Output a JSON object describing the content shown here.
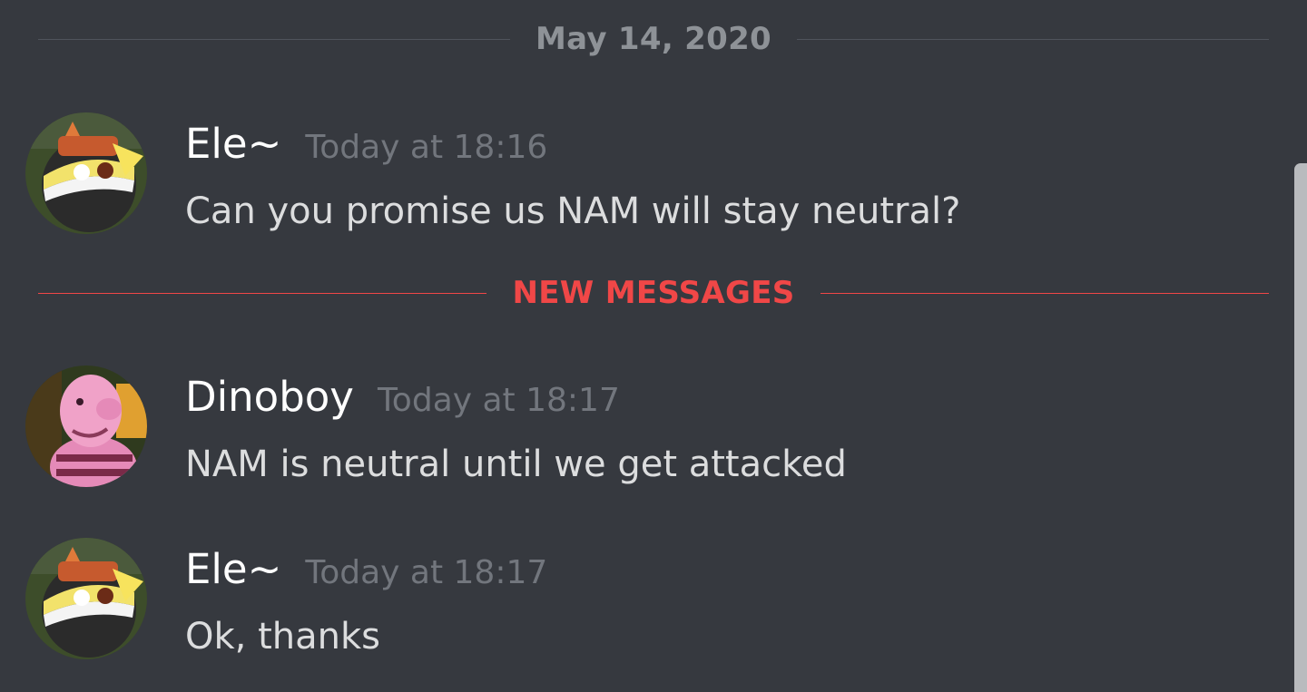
{
  "date_divider": {
    "label": "May 14, 2020"
  },
  "new_messages_divider": {
    "label": "NEW MESSAGES"
  },
  "messages": [
    {
      "username": "Ele~",
      "timestamp": "Today at 18:16",
      "content": "Can you promise us NAM will stay neutral?"
    },
    {
      "username": "Dinoboy",
      "timestamp": "Today at 18:17",
      "content": "NAM is neutral until we get attacked"
    },
    {
      "username": "Ele~",
      "timestamp": "Today at 18:17",
      "content": "Ok, thanks"
    }
  ],
  "colors": {
    "background": "#36393f",
    "new_messages_accent": "#f04747",
    "username": "#ffffff",
    "timestamp": "#72767d",
    "message_text": "#dcddde"
  }
}
